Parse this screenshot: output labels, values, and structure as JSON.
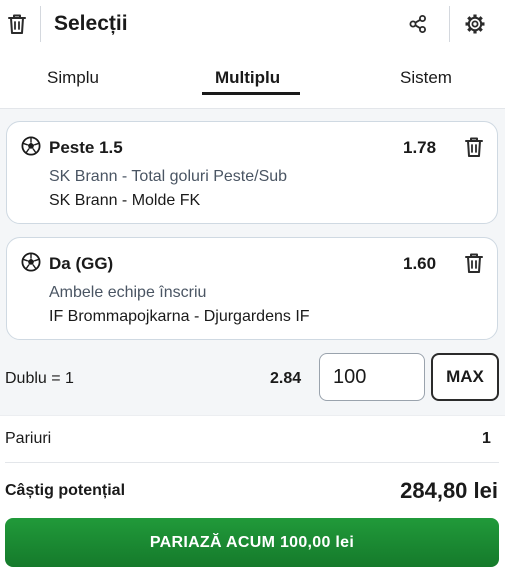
{
  "header": {
    "title": "Selecții",
    "icons": [
      "trash-icon",
      "share-icon",
      "gear-icon"
    ]
  },
  "tabs": [
    {
      "label": "Simplu",
      "active": false
    },
    {
      "label": "Multiplu",
      "active": true
    },
    {
      "label": "Sistem",
      "active": false
    }
  ],
  "selections": [
    {
      "selection": "Peste 1.5",
      "odds": "1.78",
      "market": "SK Brann - Total goluri Peste/Sub",
      "event": "SK Brann - Molde FK"
    },
    {
      "selection": "Da (GG)",
      "odds": "1.60",
      "market": "Ambele echipe înscriu",
      "event": "IF Brommapojkarna - Djurgardens IF"
    }
  ],
  "stake": {
    "combo_label": "Dublu = 1",
    "total_odds": "2.84",
    "amount": "100",
    "max_label": "MAX"
  },
  "summary": {
    "bets_label": "Pariuri",
    "bets_value": "1",
    "potential_label": "Câștig potențial",
    "potential_value": "284,80 lei"
  },
  "place_bet_label": "PARIAZĂ ACUM 100,00 lei",
  "colors": {
    "accent_green": "#1a8a33",
    "text": "#1a1a1a",
    "card_border": "#cfd9e2"
  }
}
